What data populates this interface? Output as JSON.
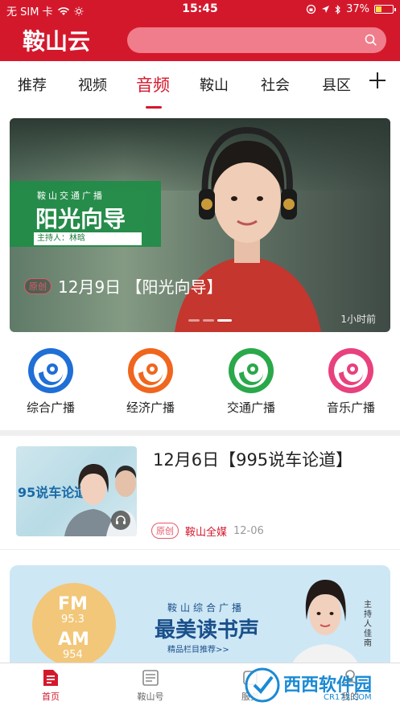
{
  "status_bar": {
    "carrier": "无 SIM 卡",
    "time": "15:45",
    "battery": "37%",
    "battery_level": 0.37
  },
  "header": {
    "logo": "鞍山云"
  },
  "tabs": [
    {
      "label": "推荐"
    },
    {
      "label": "视频"
    },
    {
      "label": "音频"
    },
    {
      "label": "鞍山"
    },
    {
      "label": "社会"
    },
    {
      "label": "县区"
    }
  ],
  "banner": {
    "subtitle": "鞍山交通广播",
    "program": "阳光向导",
    "host": "主持人：林晗",
    "tag": "原创",
    "title": "12月9日 【阳光向导】",
    "time_ago": "1小时前"
  },
  "channels": [
    {
      "label": "综合广播",
      "color": "#1f6fd6"
    },
    {
      "label": "经济广播",
      "color": "#f0661e"
    },
    {
      "label": "交通广播",
      "color": "#2aa84a"
    },
    {
      "label": "音乐广播",
      "color": "#e8417e"
    }
  ],
  "news": {
    "title": "12月6日【995说车论道】",
    "tag": "原创",
    "source": "鞍山全媒",
    "date": "12-06",
    "thumb_text": "95说车论道"
  },
  "banner2": {
    "fm": "FM",
    "fm_num": "95.3",
    "am": "AM",
    "am_num": "954",
    "subtitle": "鞍山综合广播",
    "title": "最美读书声",
    "tag": "精品栏目推荐>>",
    "host": "主持人 佳南"
  },
  "bottom_nav": [
    {
      "label": "首页"
    },
    {
      "label": "鞍山号"
    },
    {
      "label": "服务"
    },
    {
      "label": "我的"
    }
  ],
  "watermark": {
    "text": "西西软件园",
    "sub": "CR173.COM"
  },
  "colors": {
    "brand": "#d4182c"
  }
}
